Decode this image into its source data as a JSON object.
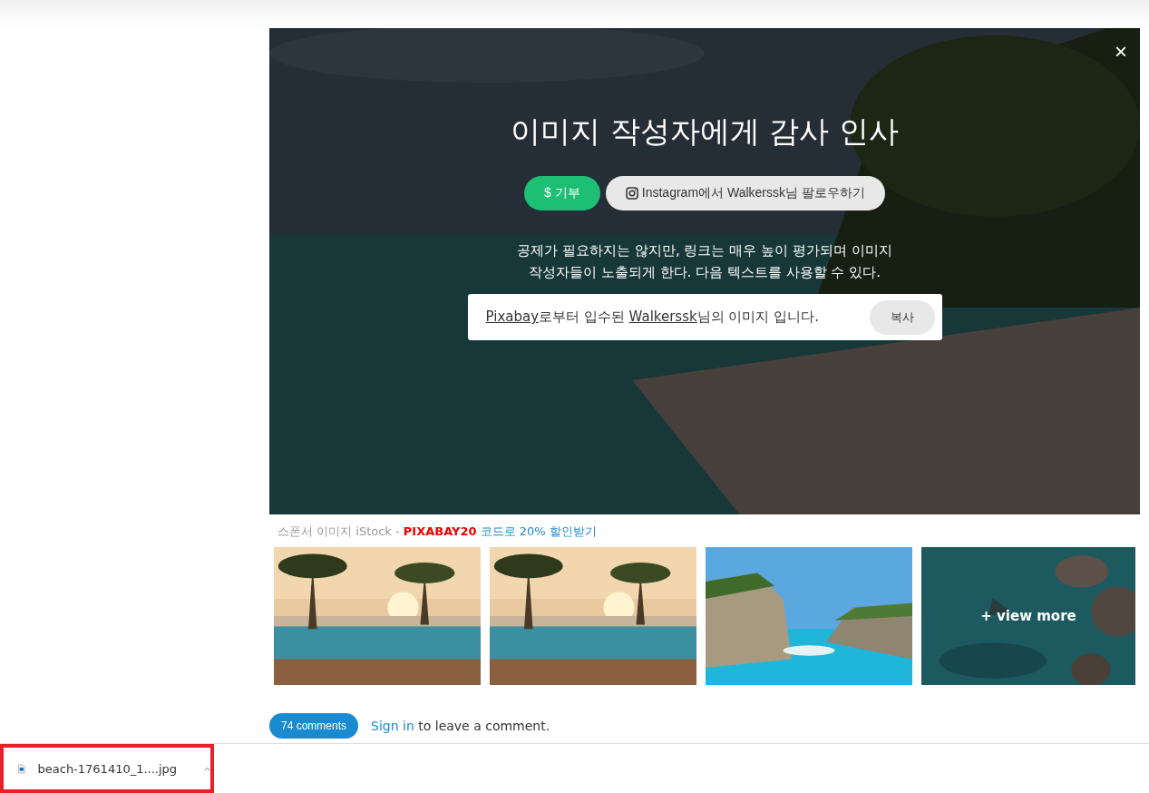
{
  "dialog": {
    "close": "×",
    "title": "이미지 작성자에게 감사 인사",
    "donate_button": "$ 기부",
    "instagram_button": "Instagram에서 Walkerssk님 팔로우하기",
    "note": "공제가 필요하지는 않지만, 링크는 매우 높이 평가되며 이미지 작성자들이 노출되게 한다. 다음 텍스트를 사용할 수 있다.",
    "attribution": [
      {
        "kind": "link",
        "text": "Pixabay"
      },
      {
        "kind": "text",
        "text": "로부터 입수된 "
      },
      {
        "kind": "link",
        "text": "Walkerssk"
      },
      {
        "kind": "text",
        "text": "님의 이미지 입니다."
      }
    ],
    "copy_button": "복사"
  },
  "sponsor": {
    "prefix": "스폰서 이미지 iStock - ",
    "code": "PIXABAY20",
    "link": "코드로 20% 할인받기"
  },
  "thumbnails": [
    {
      "kind": "sunset"
    },
    {
      "kind": "sunset"
    },
    {
      "kind": "cliff"
    },
    {
      "kind": "sea",
      "overlay": "+ view more"
    }
  ],
  "comments": {
    "count": "74 comments",
    "sign_in": "Sign in",
    "rest": "to leave a comment."
  },
  "download_bar": {
    "file": "beach-1761410_1....jpg",
    "highlighted": true
  }
}
